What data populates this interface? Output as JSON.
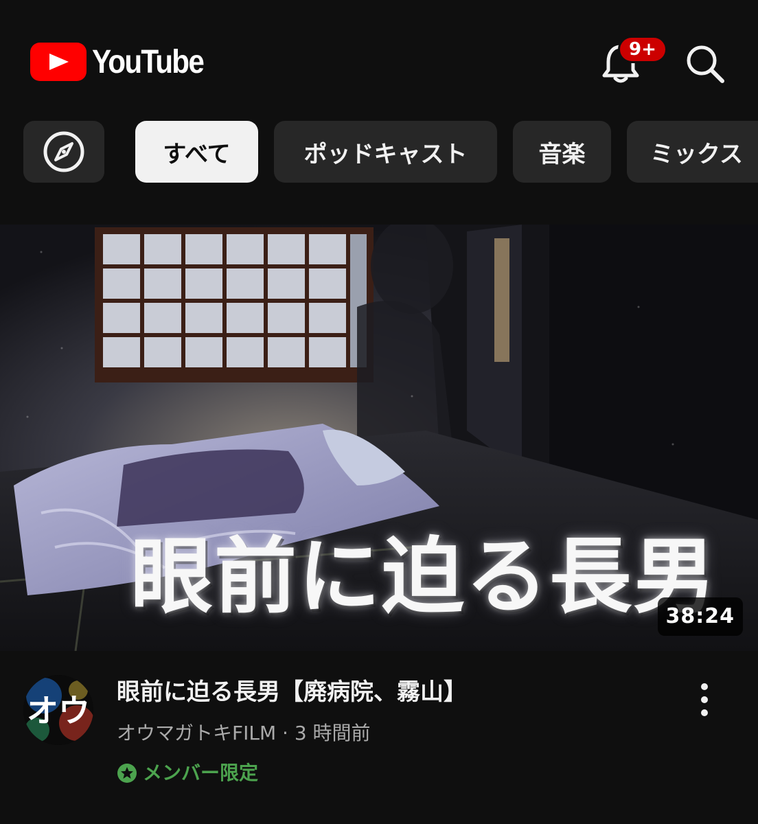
{
  "header": {
    "app_name": "YouTube",
    "notification_count": "9+",
    "icons": {
      "logo": "youtube-play-logo",
      "notifications": "bell-icon",
      "search": "search-icon"
    }
  },
  "chips": {
    "explore_icon": "compass-icon",
    "items": [
      {
        "label": "すべて",
        "selected": true
      },
      {
        "label": "ポッドキャスト",
        "selected": false
      },
      {
        "label": "音楽",
        "selected": false
      },
      {
        "label": "ミックス",
        "selected": false
      }
    ]
  },
  "video": {
    "thumbnail_text": "眼前に迫る長男",
    "duration": "38:24",
    "title": "眼前に迫る長男【廃病院、霧山】",
    "channel": "オウマガトキFILM",
    "separator": "·",
    "age": "3 時間前",
    "badge": "メンバー限定",
    "avatar_text": "オウ",
    "menu_icon": "more-vert-icon"
  },
  "colors": {
    "background": "#0f0f0f",
    "chip": "#272727",
    "chip_selected": "#f1f1f1",
    "accent_red": "#ff0000",
    "badge_red": "#cc0000",
    "members_green": "#4ca34e",
    "secondary_text": "#aaaaaa"
  }
}
